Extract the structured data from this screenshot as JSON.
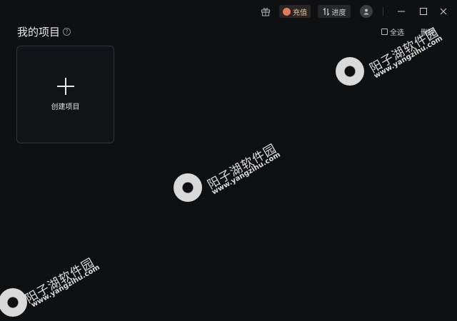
{
  "titlebar": {
    "recharge_label": "充值",
    "progress_label": "进度",
    "icons": [
      "gift-icon",
      "cloud-icon",
      "sort-icon",
      "user-icon",
      "minimize-icon",
      "maximize-icon",
      "close-icon"
    ]
  },
  "header": {
    "title": "我的项目",
    "help_glyph": "?",
    "select_all_label": "全选",
    "delete_label": "删除"
  },
  "create_card": {
    "label": "创建项目"
  },
  "watermark": {
    "brand": "阳子湖软件园",
    "url": "www.yangzihu.com"
  },
  "colors": {
    "background": "#0f1012",
    "card_border": "#34353a",
    "recharge_accent": "#e07b62"
  }
}
